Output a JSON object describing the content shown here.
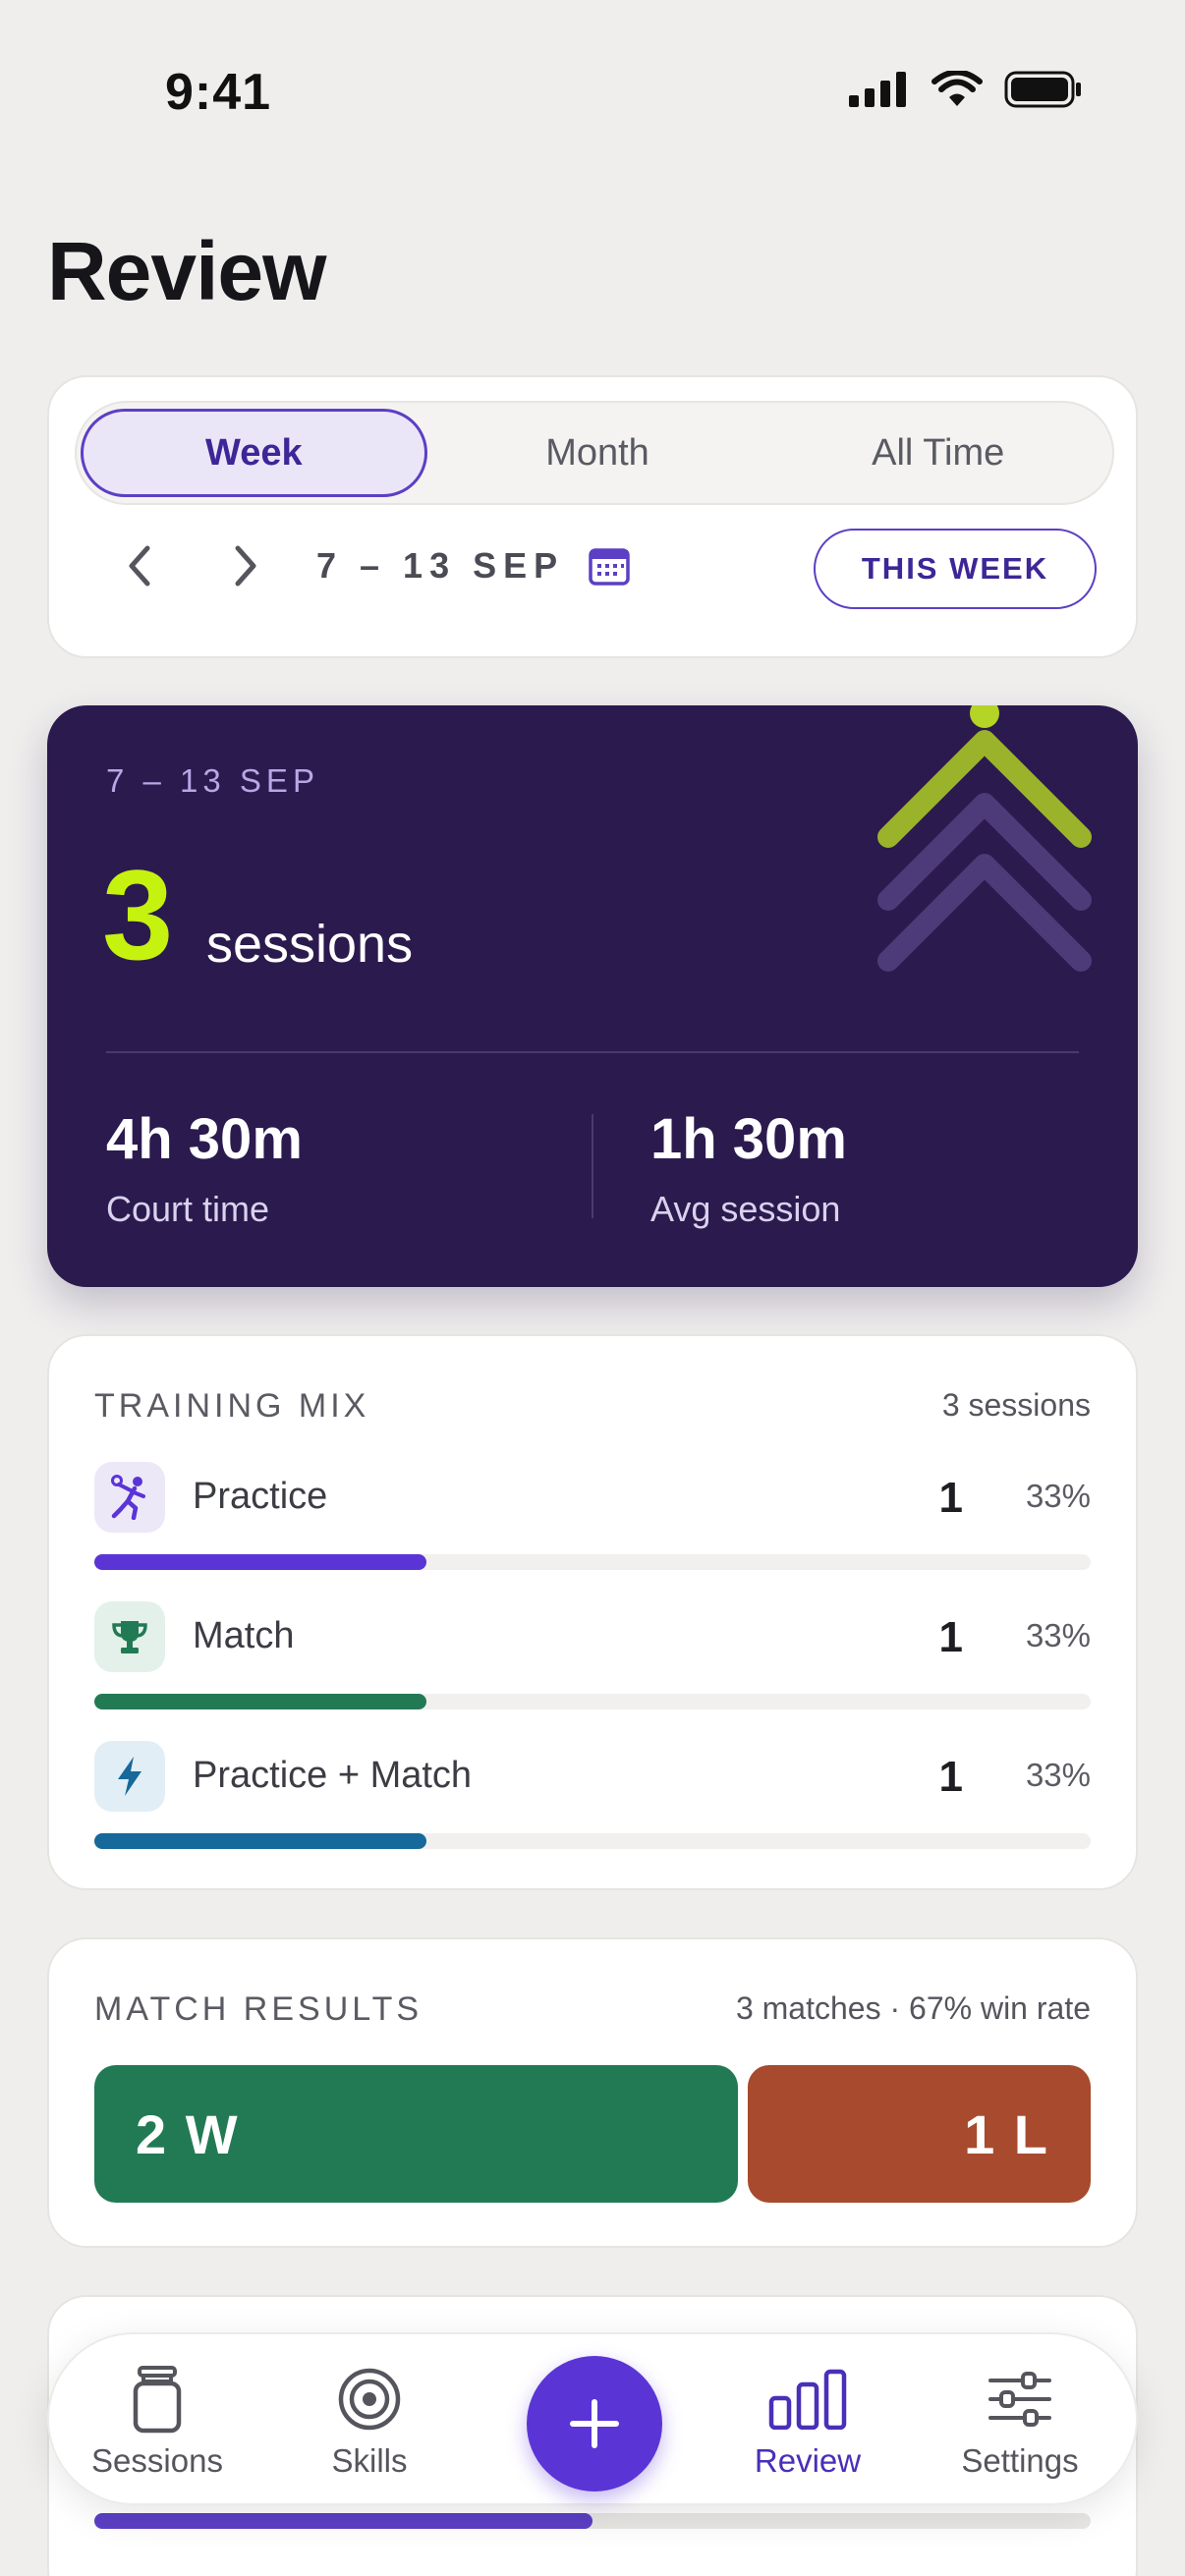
{
  "status_bar": {
    "time": "9:41"
  },
  "page": {
    "title": "Review"
  },
  "period": {
    "tabs": [
      {
        "label": "Week",
        "active": true
      },
      {
        "label": "Month",
        "active": false
      },
      {
        "label": "All Time",
        "active": false
      }
    ],
    "range": "7 – 13 SEP",
    "this_week_label": "THIS WEEK"
  },
  "summary": {
    "range": "7 – 13 SEP",
    "count": "3",
    "unit": "sessions",
    "court_time": {
      "value": "4h 30m",
      "label": "Court time"
    },
    "avg_session": {
      "value": "1h 30m",
      "label": "Avg session"
    }
  },
  "training_mix": {
    "title": "TRAINING MIX",
    "meta": "3 sessions",
    "rows": [
      {
        "label": "Practice",
        "count": "1",
        "pct": "33%",
        "fraction": 0.333,
        "color": "#5b34d6",
        "icon_bg": "#ece8f8",
        "icon": "volleyball-player-icon"
      },
      {
        "label": "Match",
        "count": "1",
        "pct": "33%",
        "fraction": 0.333,
        "color": "#227a54",
        "icon_bg": "#e3f1ea",
        "icon": "trophy-icon"
      },
      {
        "label": "Practice + Match",
        "count": "1",
        "pct": "33%",
        "fraction": 0.333,
        "color": "#16699a",
        "icon_bg": "#e1eef6",
        "icon": "lightning-icon"
      }
    ]
  },
  "match_results": {
    "title": "MATCH RESULTS",
    "meta": "3 matches · 67% win rate",
    "wins": "2 W",
    "losses": "1 L",
    "win_color": "#227a54",
    "loss_color": "#a74a2d"
  },
  "tab_bar": {
    "items": [
      {
        "label": "Sessions",
        "icon": "jar-icon",
        "active": false
      },
      {
        "label": "Skills",
        "icon": "target-icon",
        "active": false
      },
      {
        "label": "Review",
        "icon": "bar-chart-icon",
        "active": true
      },
      {
        "label": "Settings",
        "icon": "sliders-icon",
        "active": false
      }
    ],
    "fab_icon": "plus-icon"
  },
  "colors": {
    "accent": "#5b34d6",
    "hero_bg": "#2b1a4e",
    "lime": "#c6f20f"
  }
}
